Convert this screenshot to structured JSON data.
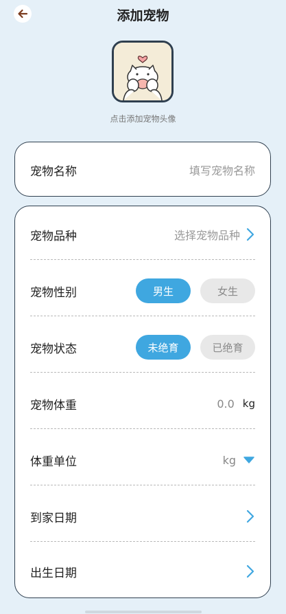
{
  "header": {
    "title": "添加宠物"
  },
  "avatar": {
    "hint": "点击添加宠物头像"
  },
  "name_field": {
    "label": "宠物名称",
    "placeholder": "填写宠物名称"
  },
  "breed": {
    "label": "宠物品种",
    "placeholder": "选择宠物品种"
  },
  "gender": {
    "label": "宠物性别",
    "options": [
      "男生",
      "女生"
    ],
    "selected": "男生"
  },
  "status": {
    "label": "宠物状态",
    "options": [
      "未绝育",
      "已绝育"
    ],
    "selected": "未绝育"
  },
  "weight": {
    "label": "宠物体重",
    "value": "0.0",
    "unit": "kg"
  },
  "weight_unit": {
    "label": "体重单位",
    "value": "kg"
  },
  "arrival_date": {
    "label": "到家日期"
  },
  "birth_date": {
    "label": "出生日期"
  },
  "colors": {
    "accent": "#3fa7e0",
    "border": "#2f3f4f",
    "background": "#e5f0f8"
  }
}
